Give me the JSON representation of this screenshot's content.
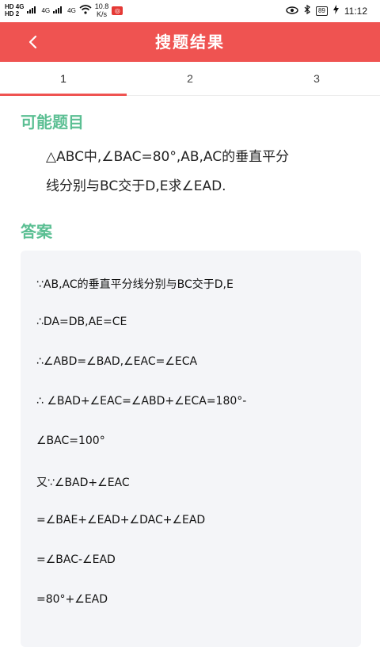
{
  "status_bar": {
    "hd_top": "HD 4G",
    "hd_bottom": "HD 2",
    "signal_1": "4G",
    "signal_2": "4G",
    "speed_value": "10.8",
    "speed_unit": "K/s",
    "battery": "89",
    "time": "11:12"
  },
  "header": {
    "title": "搜题结果",
    "background_color": "#ef5351"
  },
  "tabs": [
    {
      "label": "1",
      "active": true
    },
    {
      "label": "2",
      "active": false
    },
    {
      "label": "3",
      "active": false
    }
  ],
  "question_section": {
    "title": "可能题目",
    "lines": [
      "△ABC中,∠BAC=80°,AB,AC的垂直平分",
      "线分别与BC交于D,E求∠EAD."
    ]
  },
  "answer_section": {
    "title": "答案",
    "lines": [
      "∵AB,AC的垂直平分线分别与BC交于D,E",
      "∴DA=DB,AE=CE",
      "∴∠ABD=∠BAD,∠EAC=∠ECA",
      "∴ ∠BAD+∠EAC=∠ABD+∠ECA=180°-",
      "∠BAC=100°",
      "又∵∠BAD+∠EAC",
      "=∠BAE+∠EAD+∠DAC+∠EAD",
      "=∠BAC-∠EAD",
      "=80°+∠EAD"
    ]
  },
  "accent_color": "#5bbf93"
}
